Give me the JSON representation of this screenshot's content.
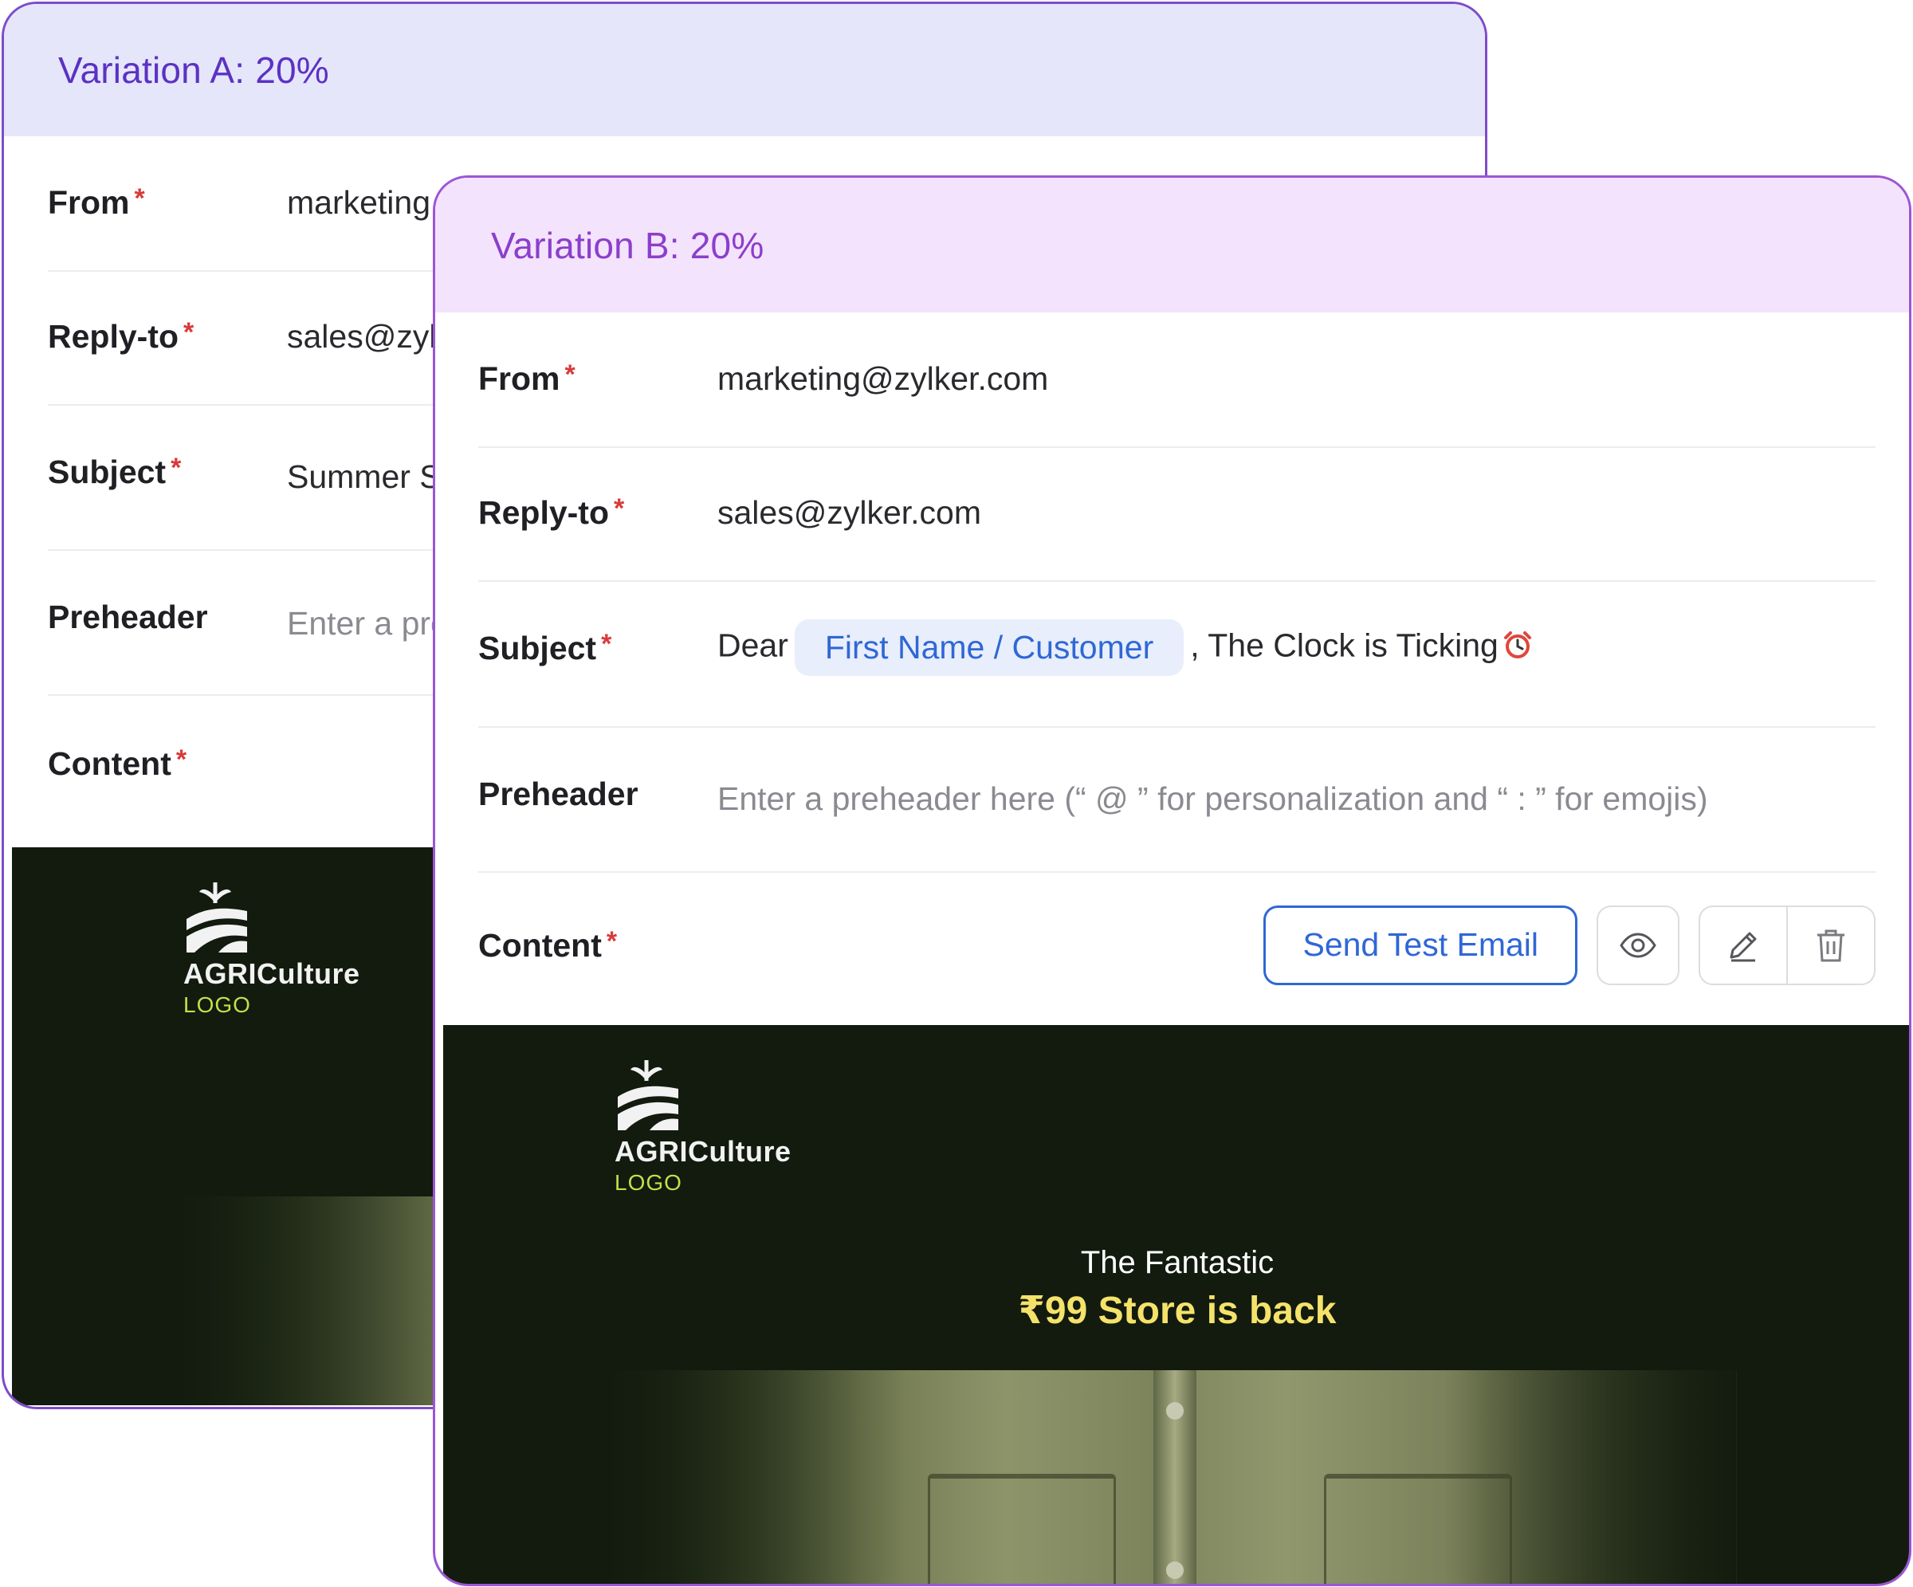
{
  "variation_a": {
    "title": "Variation A: 20%",
    "fields": {
      "from": {
        "label": "From",
        "value": "marketing"
      },
      "reply_to": {
        "label": "Reply-to",
        "value": "sales@zyl"
      },
      "subject": {
        "label": "Subject",
        "value": "Summer S"
      },
      "preheader": {
        "label": "Preheader",
        "placeholder": "Enter a pre"
      },
      "content": {
        "label": "Content"
      }
    },
    "preview": {
      "logo_word": "AGRICulture",
      "logo_sub": "LOGO"
    }
  },
  "variation_b": {
    "title": "Variation B: 20%",
    "fields": {
      "from": {
        "label": "From",
        "value": "marketing@zylker.com"
      },
      "reply_to": {
        "label": "Reply-to",
        "value": "sales@zylker.com"
      },
      "subject": {
        "label": "Subject",
        "prefix": "Dear",
        "merge_tag": "First Name / Customer",
        "suffix": ", The Clock is Ticking",
        "emoji_icon": "alarm-clock-icon"
      },
      "preheader": {
        "label": "Preheader",
        "placeholder": "Enter a preheader here (“ @ ” for personalization and “ : ” for emojis)"
      },
      "content": {
        "label": "Content",
        "send_test_label": "Send Test Email",
        "icons": [
          "eye-icon",
          "pencil-icon",
          "trash-icon"
        ]
      }
    },
    "preview": {
      "logo_word": "AGRICulture",
      "logo_sub": "LOGO",
      "headline_line1": "The Fantastic",
      "headline_line2": "₹99 Store is back"
    }
  },
  "required_marker": "*",
  "colors": {
    "accent_blue": "#2f67d6",
    "required_red": "#d93a3a",
    "header_a_bg": "#e6e6fb",
    "header_b_bg": "#f4e3fc",
    "email_bg": "#121b0e",
    "headline_yellow": "#f5e26a"
  }
}
